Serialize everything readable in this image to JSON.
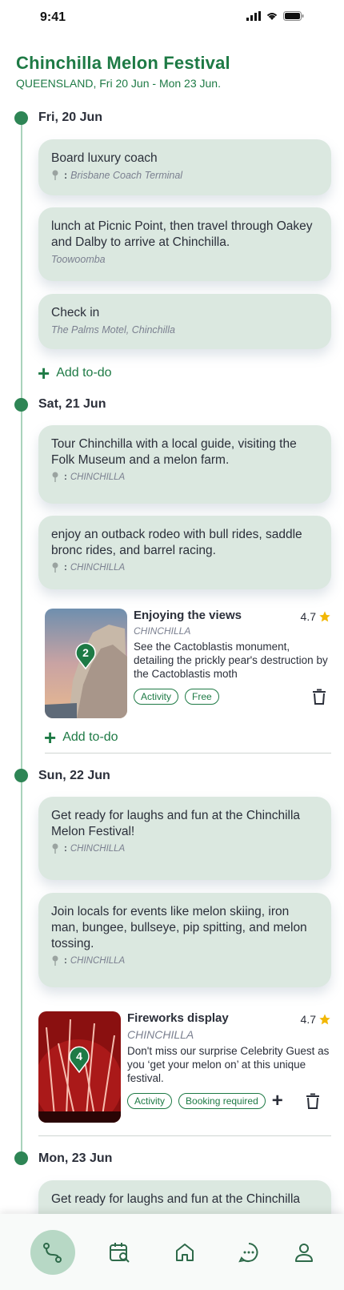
{
  "status": {
    "time": "9:41"
  },
  "header": {
    "title": "Chinchilla Melon Festival",
    "subtitle": "QUEENSLAND, Fri 20 Jun - Mon 23 Jun."
  },
  "days": [
    {
      "label": "Fri, 20 Jun",
      "items": [
        {
          "title": "Board luxury coach",
          "location": "Brisbane Coach Terminal"
        },
        {
          "title": "lunch at Picnic Point, then travel through Oakey and Dalby to arrive at Chinchilla.",
          "location": "Toowoomba"
        },
        {
          "title": "Check in",
          "location": "The Palms Motel, Chinchilla"
        }
      ],
      "add_label": "Add to-do"
    },
    {
      "label": "Sat, 21 Jun",
      "items": [
        {
          "title": "Tour Chinchilla with a local guide, visiting the Folk Museum and a melon farm.",
          "location": "CHINCHILLA"
        },
        {
          "title": "enjoy an outback rodeo with bull rides, saddle bronc rides, and barrel racing.",
          "location": "CHINCHILLA"
        }
      ],
      "poi": {
        "marker": "2",
        "name": "Enjoying the views",
        "rating": "4.7",
        "location": "CHINCHILLA",
        "description": "See the Cactoblastis monument, detailing the prickly pear's destruction by the Cactoblastis moth",
        "tags": [
          "Activity",
          "Free"
        ]
      },
      "add_label": "Add to-do"
    },
    {
      "label": "Sun, 22 Jun",
      "items": [
        {
          "title": "Get ready for laughs and fun at the Chinchilla Melon Festival!",
          "location": "CHINCHILLA"
        },
        {
          "title": "Join locals for events like melon skiing, iron man, bungee, bullseye, pip spitting, and melon tossing.",
          "location": "CHINCHILLA"
        }
      ],
      "poi": {
        "marker": "4",
        "name": "Fireworks display",
        "rating": "4.7",
        "location": "CHINCHILLA",
        "description": "Don't miss our surprise Celebrity Guest as you ‘get your melon on’ at this unique festival.",
        "tags": [
          "Activity",
          "Booking required"
        ]
      }
    },
    {
      "label": "Mon, 23 Jun",
      "items": [
        {
          "title": "Get ready for laughs and fun at the Chinchilla"
        }
      ]
    }
  ],
  "nav": {
    "items": [
      "itinerary-icon",
      "calendar-search-icon",
      "home-icon",
      "chat-icon",
      "profile-icon"
    ],
    "active": "itinerary-icon"
  },
  "colors": {
    "accent": "#1e7a45",
    "card": "#dbe8e0",
    "star": "#f2b705"
  }
}
